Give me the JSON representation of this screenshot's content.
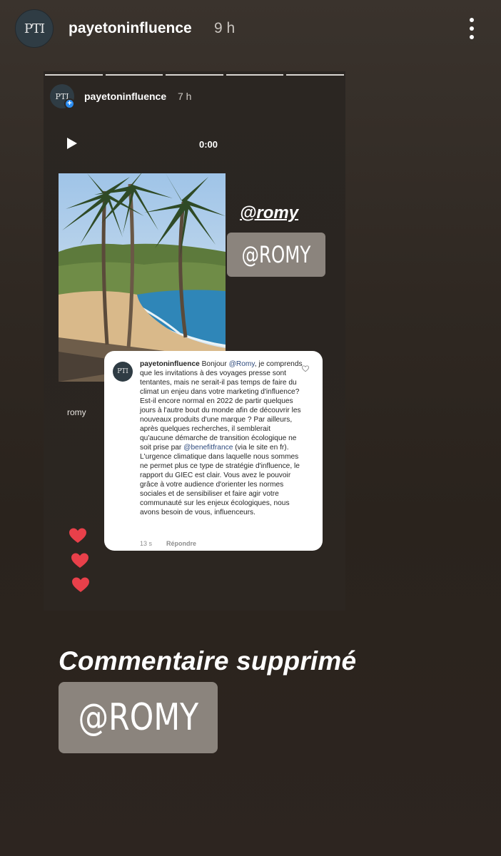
{
  "header": {
    "avatar_initials": "PTI",
    "username": "payetoninfluence",
    "time": "9 h",
    "more_icon": "more-vertical-icon"
  },
  "story": {
    "progress_segments": 5,
    "avatar_initials": "PTI",
    "username": "payetoninfluence",
    "time": "7 h",
    "audio_time": "0:00",
    "romy_italic": "@romy",
    "romy_sticker": "@ROMY",
    "romy_label": "romy",
    "hearts_count": 3,
    "heart_color": "#e8404a"
  },
  "comment": {
    "avatar_initials": "PTI",
    "username": "payetoninfluence",
    "text_1": " Bonjour ",
    "mention_1": "@Romy",
    "text_2": ", je comprends que les invitations à des voyages presse sont tentantes, mais ne serait-il pas temps de faire du climat un enjeu dans votre marketing d'influence?  Est-il encore normal en 2022 de partir quelques jours à l'autre bout du monde afin de découvrir les nouveaux produits d'une marque ? Par ailleurs, après quelques recherches, il semblerait qu'aucune démarche de transition écologique ne soit prise par ",
    "mention_2": "@benefitfrance",
    "text_3": " (via le site en fr). L'urgence climatique dans laquelle nous sommes ne permet plus ce type de stratégie d'influence, le rapport du GIEC est clair. Vous avez le pouvoir grâce à votre audience d'orienter les normes sociales et de sensibiliser et faire agir votre communauté sur les enjeux écologiques, nous avons besoin de vous, influenceurs.",
    "time": "13 s",
    "reply_label": "Répondre"
  },
  "caption": {
    "title": "Commentaire supprimé",
    "sticker": "@ROMY"
  },
  "colors": {
    "sticker_bg": "#8b847d",
    "mention": "#2e4a7d",
    "badge": "#2b8cf0"
  }
}
